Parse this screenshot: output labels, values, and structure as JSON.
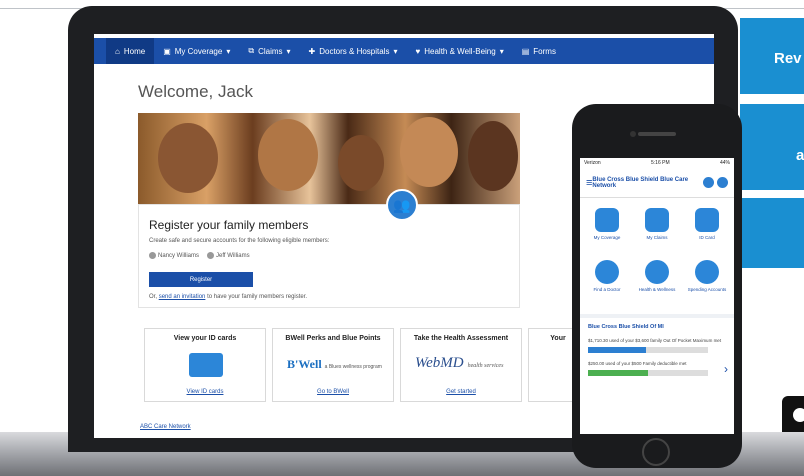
{
  "promo": {
    "block1": "Rev",
    "block2": "a"
  },
  "site": {
    "nav": [
      {
        "label": "Home",
        "icon": "home-icon"
      },
      {
        "label": "My Coverage",
        "icon": "coverage-icon"
      },
      {
        "label": "Claims",
        "icon": "claims-icon"
      },
      {
        "label": "Doctors & Hospitals",
        "icon": "plus-icon"
      },
      {
        "label": "Health & Well-Being",
        "icon": "heart-icon"
      },
      {
        "label": "Forms",
        "icon": "forms-icon"
      }
    ],
    "welcome": "Welcome, Jack",
    "register": {
      "title": "Register your family members",
      "subtitle": "Create safe and secure accounts for the following eligible members:",
      "members": [
        "Nancy Williams",
        "Jeff Williams"
      ],
      "button": "Register",
      "invite_prefix": "Or,",
      "invite_link": "send an invitation",
      "invite_suffix": "to have your family members register."
    },
    "cards": [
      {
        "title": "View your ID cards",
        "link": "View ID cards"
      },
      {
        "title": "BWell Perks and Blue Points",
        "brand": "B'Well",
        "brand_sub": "a Blues wellness program",
        "link": "Go to BWell"
      },
      {
        "title": "Take the Health Assessment",
        "brand": "WebMD",
        "brand_sub": "health services",
        "link": "Get started"
      },
      {
        "title": "Your"
      }
    ],
    "footer_link": "ABC Care Network"
  },
  "phone": {
    "status": {
      "carrier": "Verizon",
      "time": "5:16 PM",
      "battery": "44%"
    },
    "logo": "Blue Cross Blue Shield Blue Care Network",
    "tiles": [
      "My Coverage",
      "My Claims",
      "ID Card",
      "Find a Doctor",
      "Health & Wellness",
      "Spending Accounts"
    ],
    "plan": "Blue Cross Blue Shield Of MI",
    "deductible1": "$1,710.30 used of your $3,600 family Out Of Pocket Maximum met",
    "deductible1_fraction": 0.48,
    "deductible2": "$250.00 used of your $500 Family deductible met",
    "deductible2_fraction": 0.5,
    "colors": {
      "bar1": "#2c7fd1",
      "bar2": "#4caf50"
    }
  }
}
